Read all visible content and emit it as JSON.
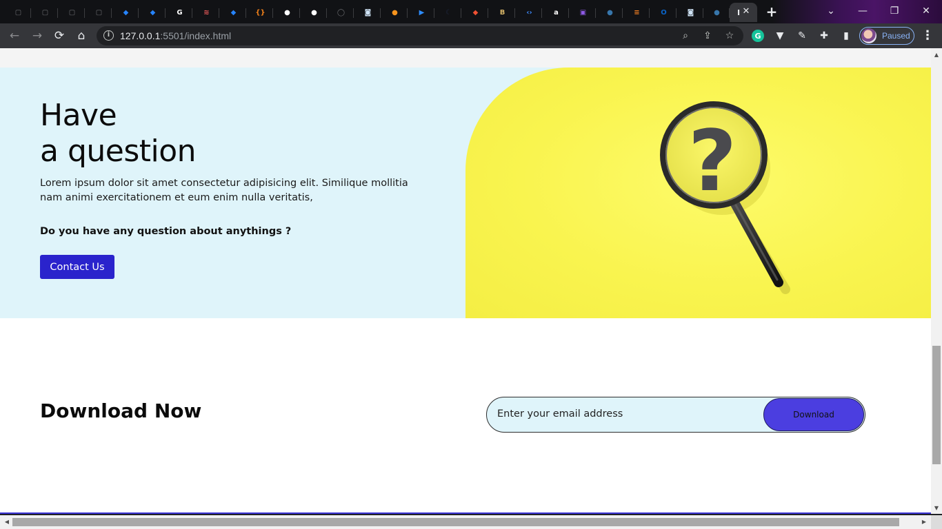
{
  "browser": {
    "tabs": [
      {
        "icon": "square-outline-icon",
        "color": "#2a2b2f"
      },
      {
        "icon": "square-outline-icon",
        "color": "#2a2b2f"
      },
      {
        "icon": "square-outline-icon",
        "color": "#2a2b2f"
      },
      {
        "icon": "square-outline-icon",
        "color": "#2a2b2f"
      },
      {
        "icon": "jira-diamond-icon",
        "color": "#2684ff"
      },
      {
        "icon": "jira-diamond-icon",
        "color": "#2684ff"
      },
      {
        "icon": "google-icon",
        "color": "#ffffff"
      },
      {
        "icon": "stack-layers-icon",
        "color": "#e45858"
      },
      {
        "icon": "jira-diamond-icon",
        "color": "#2684ff"
      },
      {
        "icon": "curly-braces-icon",
        "color": "#f0801a"
      },
      {
        "icon": "globe-icon",
        "color": "#ffffff"
      },
      {
        "icon": "globe-icon",
        "color": "#ffffff"
      },
      {
        "icon": "github-icon",
        "color": "#2a2b2f"
      },
      {
        "icon": "camera-icon",
        "color": "#cfe3f5"
      },
      {
        "icon": "orange-circle-icon",
        "color": "#f7941d"
      },
      {
        "icon": "zoom-icon",
        "color": "#2d8cff"
      },
      {
        "icon": "moon-icon",
        "color": "#1f2a44"
      },
      {
        "icon": "git-icon",
        "color": "#f05133"
      },
      {
        "icon": "bootstrap-icon",
        "color": "#d7b567"
      },
      {
        "icon": "code-brackets-icon",
        "color": "#3f8cff"
      },
      {
        "icon": "amazon-icon",
        "color": "#ffffff"
      },
      {
        "icon": "purple-box-icon",
        "color": "#8e5ae5"
      },
      {
        "icon": "python-icon",
        "color": "#3776ab"
      },
      {
        "icon": "stackoverflow-icon",
        "color": "#f48024"
      },
      {
        "icon": "outlook-icon",
        "color": "#0a64c8"
      },
      {
        "icon": "camera-icon",
        "color": "#cfe3f5"
      },
      {
        "icon": "python-icon",
        "color": "#3776ab"
      }
    ],
    "active_tab_label": "I",
    "url_host": "127.0.0.1",
    "url_path": ":5501/index.html",
    "profile_status": "Paused"
  },
  "hero": {
    "title_line1": "Have",
    "title_line2": "a question",
    "description": "Lorem ipsum dolor sit amet consectetur adipisicing elit. Similique mollitia nam animi exercitationem et eum enim nulla veritatis,",
    "question": "Do you have any question about anythings ?",
    "button_label": "Contact Us",
    "image_alt": "magnifying-glass-question-mark"
  },
  "download": {
    "title_bold": "Download",
    "title_rest": "Now",
    "email_placeholder": "Enter your email address",
    "button_label": "Download"
  },
  "colors": {
    "hero_bg": "#dff4fa",
    "hero_image_bg": "#fbf756",
    "primary_button": "#2a23cc",
    "download_button": "#4b3ee0"
  }
}
